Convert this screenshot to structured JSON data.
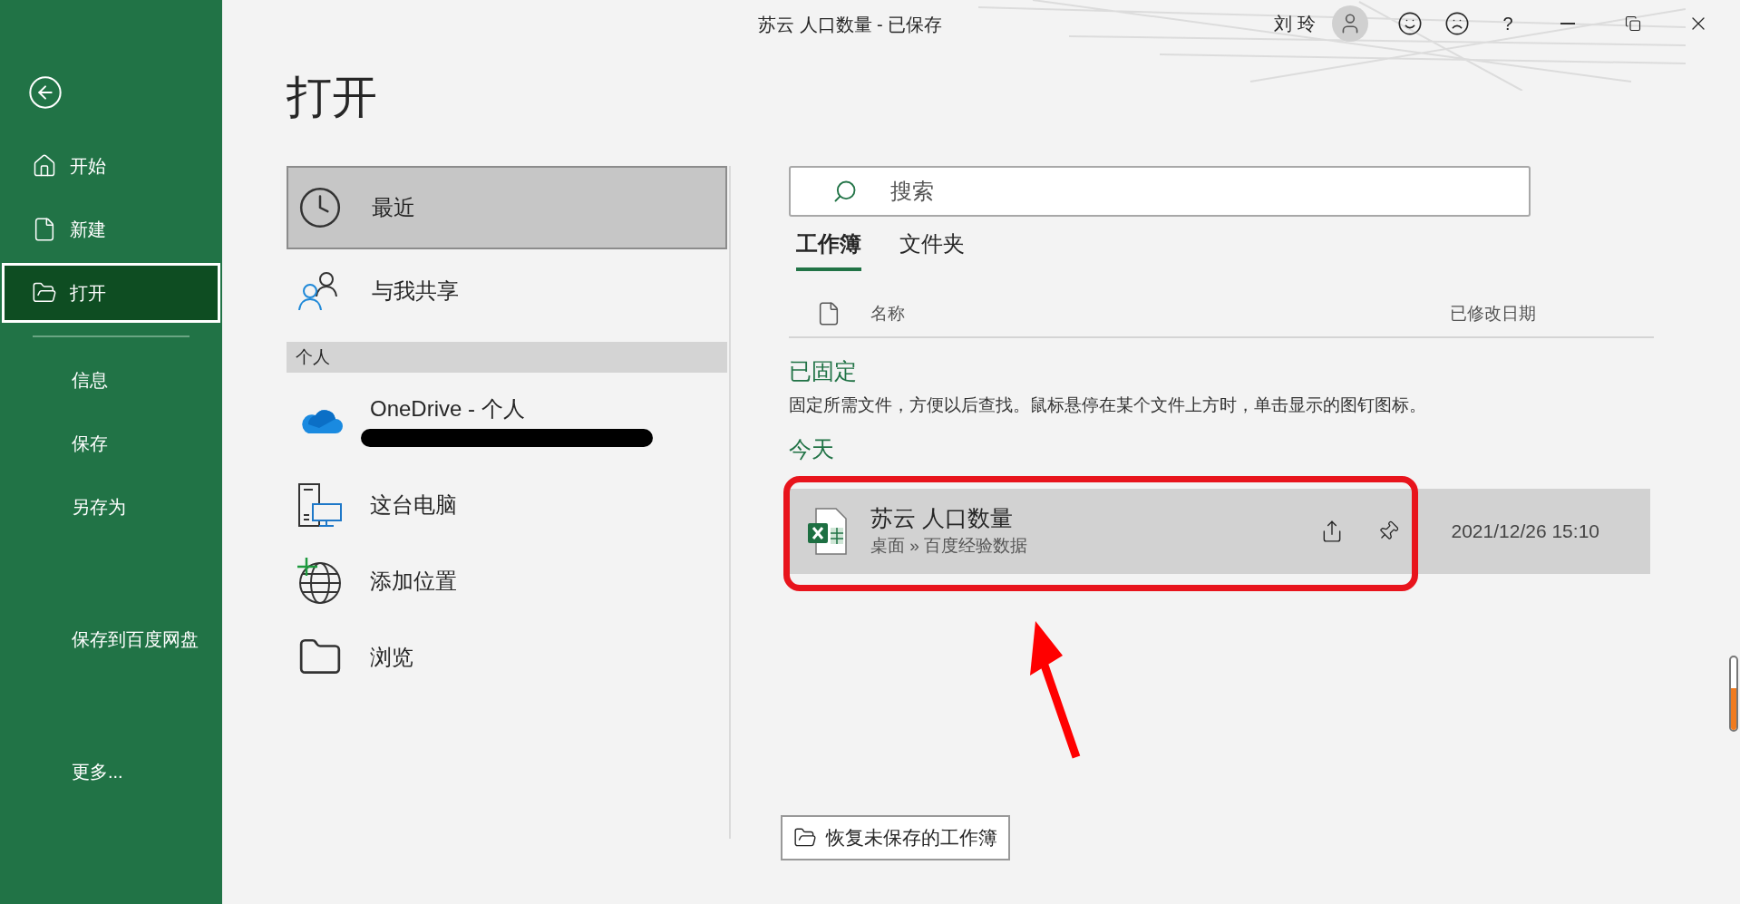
{
  "title_bar": {
    "title": "苏云 人口数量 - 已保存",
    "user": "刘 玲",
    "help": "?"
  },
  "sidebar": {
    "primary": [
      {
        "label": "开始",
        "selected": false
      },
      {
        "label": "新建",
        "selected": false
      },
      {
        "label": "打开",
        "selected": true
      }
    ],
    "secondary": [
      {
        "label": "信息",
        "selected": false
      },
      {
        "label": "保存",
        "selected": false
      },
      {
        "label": "另存为",
        "selected": false
      }
    ],
    "extra": [
      {
        "label": "保存到百度网盘",
        "selected": false
      }
    ],
    "more": {
      "label": "更多...",
      "selected": false
    }
  },
  "page_title": "打开",
  "locations": {
    "top": [
      {
        "label": "最近",
        "selected": true
      },
      {
        "label": "与我共享",
        "selected": false
      }
    ],
    "section": "个人",
    "personal": [
      {
        "label": "OneDrive - 个人",
        "selected": false,
        "redacted": true
      },
      {
        "label": "这台电脑",
        "selected": false,
        "redacted": false
      },
      {
        "label": "添加位置",
        "selected": false,
        "redacted": false
      },
      {
        "label": "浏览",
        "selected": false,
        "redacted": false
      }
    ]
  },
  "files": {
    "search": {
      "placeholder": "搜索"
    },
    "tabs": [
      {
        "label": "工作簿",
        "selected": true
      },
      {
        "label": "文件夹",
        "selected": false
      }
    ],
    "columns": {
      "name": "名称",
      "modified": "已修改日期"
    },
    "pinned": {
      "heading": "已固定",
      "hint": "固定所需文件，方便以后查找。鼠标悬停在某个文件上方时，单击显示的图钉图标。"
    },
    "groups": [
      {
        "heading": "今天",
        "files": [
          {
            "name": "苏云 人口数量",
            "path": "桌面 » 百度经验数据",
            "modified": "2021/12/26 15:10",
            "selected": true
          }
        ]
      }
    ]
  },
  "recover_button": "恢复未保存的工作簿"
}
